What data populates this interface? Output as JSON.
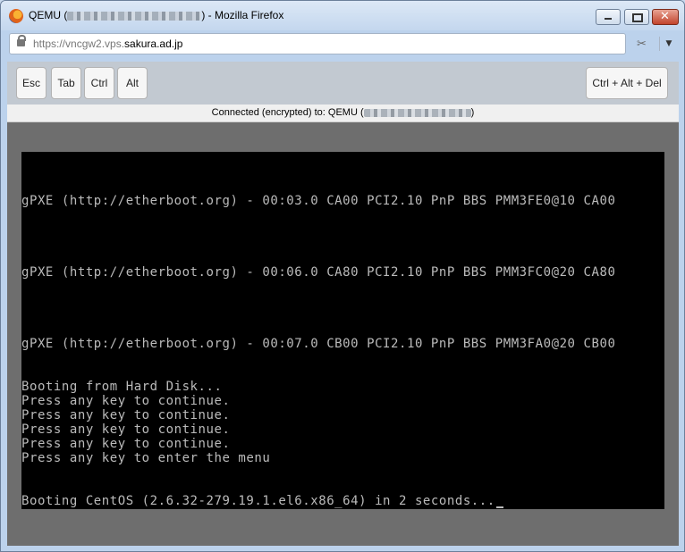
{
  "window": {
    "title_prefix": "QEMU (",
    "title_suffix": ") - Mozilla Firefox"
  },
  "url": {
    "scheme": "https://vncgw2.vps.",
    "domain": "sakura.ad.jp"
  },
  "keys": {
    "esc": "Esc",
    "tab": "Tab",
    "ctrl": "Ctrl",
    "alt": "Alt",
    "ctrl_alt_del": "Ctrl + Alt + Del"
  },
  "status": {
    "prefix": "Connected (encrypted) to: QEMU (",
    "suffix": ")"
  },
  "console": {
    "lines": [
      "gPXE (http://etherboot.org) - 00:03.0 CA00 PCI2.10 PnP BBS PMM3FE0@10 CA00",
      "gPXE (http://etherboot.org) - 00:06.0 CA80 PCI2.10 PnP BBS PMM3FC0@20 CA80",
      "gPXE (http://etherboot.org) - 00:07.0 CB00 PCI2.10 PnP BBS PMM3FA0@20 CB00",
      "Booting from Hard Disk...",
      "Press any key to continue.",
      "Press any key to continue.",
      "Press any key to continue.",
      "Press any key to continue.",
      "Press any key to enter the menu",
      "Booting CentOS (2.6.32-279.19.1.el6.x86_64) in 2 seconds..."
    ]
  }
}
